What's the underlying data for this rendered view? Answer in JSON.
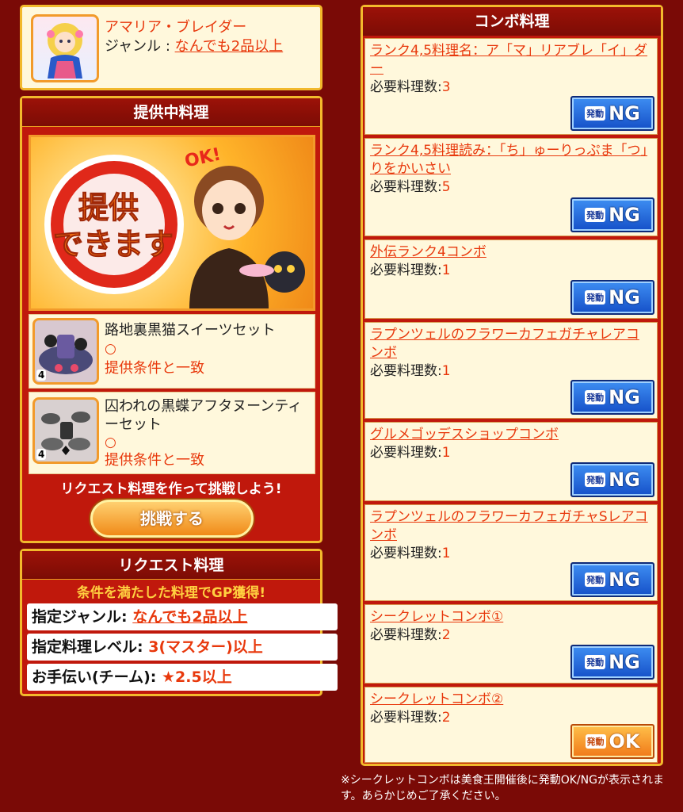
{
  "character": {
    "name": "アマリア・ブレイダー",
    "genre_prefix": "ジャンル : ",
    "genre_value": "なんでも2品以上"
  },
  "serving": {
    "title": "提供中料理",
    "banner_text_line1": "提供",
    "banner_text_line2": "できます",
    "ok_bubble": "OK!",
    "items": [
      {
        "name": "路地裏黒猫スイーツセット",
        "mark": "○",
        "status": "提供条件と一致",
        "rank": "4"
      },
      {
        "name": "囚われの黒蝶アフタヌーンティーセット",
        "mark": "○",
        "status": "提供条件と一致",
        "rank": "4"
      }
    ],
    "prompt": "リクエスト料理を作って挑戦しよう!",
    "challenge_button": "挑戦する"
  },
  "request": {
    "title": "リクエスト料理",
    "subtitle": "条件を満たした料理でGP獲得!",
    "rows": [
      {
        "label": "指定ジャンル: ",
        "value": "なんでも2品以上"
      },
      {
        "label": "指定料理レベル: ",
        "value": "3(マスター)以上"
      },
      {
        "label": "お手伝い(チーム): ",
        "value": "★2.5以上"
      }
    ]
  },
  "combo": {
    "title": "コンボ料理",
    "required_label": "必要料理数:",
    "items": [
      {
        "name": "ランク4,5料理名：ア「マ」リアブレ「イ」ダー",
        "count": "3",
        "btn_small": "発動",
        "btn_big": "NG"
      },
      {
        "name": "ランク4,5料理読み：「ち」ゅーりっぷま「つ」りをかいさい",
        "count": "5",
        "btn_small": "発動",
        "btn_big": "NG"
      },
      {
        "name": "外伝ランク4コンボ",
        "count": "1",
        "btn_small": "発動",
        "btn_big": "NG"
      },
      {
        "name": "ラプンツェルのフラワーカフェガチャレアコンボ",
        "count": "1",
        "btn_small": "発動",
        "btn_big": "NG"
      },
      {
        "name": "グルメゴッデスショップコンボ",
        "count": "1",
        "btn_small": "発動",
        "btn_big": "NG"
      },
      {
        "name": "ラプンツェルのフラワーカフェガチャSレアコンボ",
        "count": "1",
        "btn_small": "発動",
        "btn_big": "NG"
      },
      {
        "name": "シークレットコンボ①",
        "count": "2",
        "btn_small": "発動",
        "btn_big": "NG"
      },
      {
        "name": "シークレットコンボ②",
        "count": "2",
        "btn_small": "発動",
        "btn_big": "OK"
      }
    ]
  },
  "footnote": "※シークレットコンボは美食王開催後に発動OK/NGが表示されます。あらかじめご了承ください。",
  "colors": {
    "background": "#7a0a06",
    "panel_border": "#f2b92c",
    "link": "#e8380c",
    "ng_button": "#1550c8",
    "ok_button": "#f07818"
  }
}
